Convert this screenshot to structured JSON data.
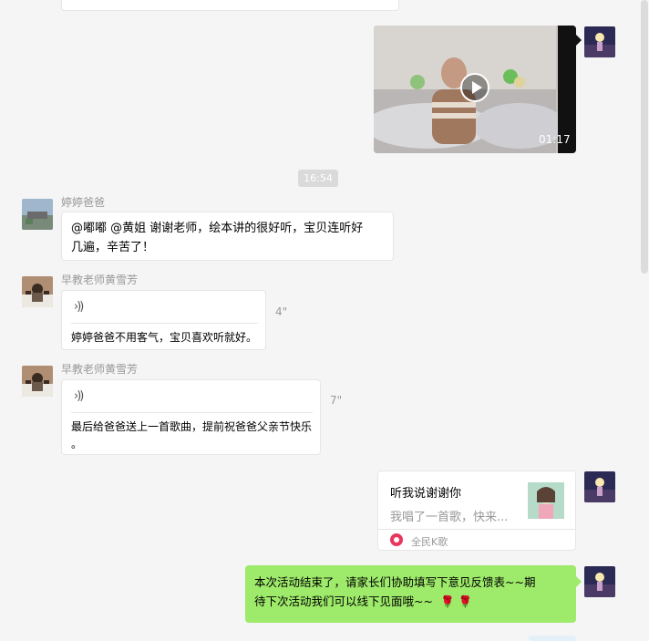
{
  "colors": {
    "bg": "#f5f5f5",
    "green_bubble": "#9eea6a",
    "white_bubble": "#ffffff",
    "sender_name": "#999999",
    "kg_brand": "#e8365d"
  },
  "video_message": {
    "duration": "01:17"
  },
  "timestamp": "16:54",
  "messages": [
    {
      "sender": "婷婷爸爸",
      "text_line1": "@嘟嘟 @黄姐 谢谢老师，绘本讲的很好听，宝贝连听好",
      "text_line2": "几遍，辛苦了！"
    },
    {
      "sender": "早教老师黄雪芳",
      "voice_duration": "4\"",
      "transcript": "婷婷爸爸不用客气，宝贝喜欢听就好。"
    },
    {
      "sender": "早教老师黄雪芳",
      "voice_duration": "7\"",
      "transcript_line1": "最后给爸爸送上一首歌曲，提前祝爸爸父亲节快乐",
      "transcript_line2": "。"
    }
  ],
  "share_card": {
    "title": "听我说谢谢你",
    "description": "我唱了一首歌，快来...",
    "source": "全民K歌"
  },
  "final_message": {
    "line1": "本次活动结束了，请家长们协助填写下意见反馈表~~期",
    "line2": "待下次活动我们可以线下见面哦~~",
    "emoji": "🌹 🌹"
  }
}
